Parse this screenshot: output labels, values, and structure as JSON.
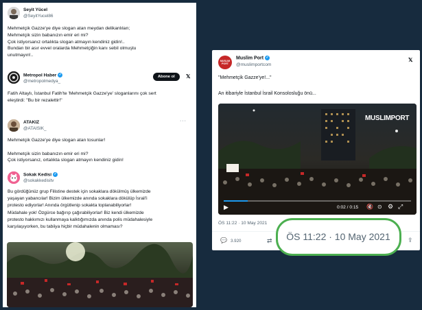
{
  "left_panel": {
    "tweets": [
      {
        "name": "Seyit Yücel",
        "handle": "@SeyitYucel86",
        "text": "Mehmetçik Gazze'ye diye slogan atan meydan delikanlıları;\nMehmetçik sizin babanızın emir eri mi?\nÇok istiyorsanız ortalıkta slogan atmayın kendiniz gidin!..\nBundan bir asır evvel oralarda Mehmetçiğin kanı sebil olmuştu\nunutmayın!.."
      },
      {
        "name": "Metropol Haber",
        "handle": "@metropolmedya_",
        "follow_label": "Abone ol",
        "text": "Fatih Altaylı, İstanbul Fatih'te 'Mehmetçik Gazze'ye' sloganlarını çok sert\neleştirdi: \"Bu bir rezalettir!\""
      },
      {
        "name": "ATAKIZ",
        "handle": "@ATAISIK_",
        "text": "Mehmetçik Gazze'ye diye slogan atan tosunlar!\n\nMehmetçik sizin babanızın emir eri mi?\nÇok istiyorsanız, ortalıkta slogan atmayın kendiniz gidin!"
      },
      {
        "name": "Sokak Kedisi",
        "handle": "@sokakkedisitv",
        "text": "Bu gördüğünüz grup Filistine destek için sokaklara dökülmüş ülkemizde\nyaşayan yabancılar! Bizim ülkemizde anında sokaklara dökülüp İsrail'i\nprotesto ediyorlar! Anında örgütlenip sokakta toplanabiliyorlar!\nMüdahale yok! Özgürce bağırıp çağırabiliyorlar! Biz kendi ülkemizde\nprotesto hakkımızı kullanmaya kalktığımızda anında polis müdahalesiyle\nkarşılaşıyorken, bu tabiiya hiçbir müdahalenin olmaması?"
      }
    ]
  },
  "right_panel": {
    "name": "Muslim Port",
    "handle": "@muslimportcom",
    "avatar_text": "MUSLIM PORT",
    "headline": "\"Mehmetçik Gazze'ye!...\"",
    "subtext": "An itibariyle İstanbul İsrail Konsolosluğu önü...",
    "video": {
      "watermark": "MUSLIMPORT",
      "time": "0:02 / 0:15",
      "progress": 0.13
    },
    "timestamp": "ÖS 11:22 · 10 May 2021",
    "replies": "3.920",
    "zoom_timestamp": "ÖS 11:22 · 10 May 2021"
  },
  "colors": {
    "background": "#172b3e",
    "verified": "#1d9bf0",
    "highlight": "#4caf50"
  }
}
